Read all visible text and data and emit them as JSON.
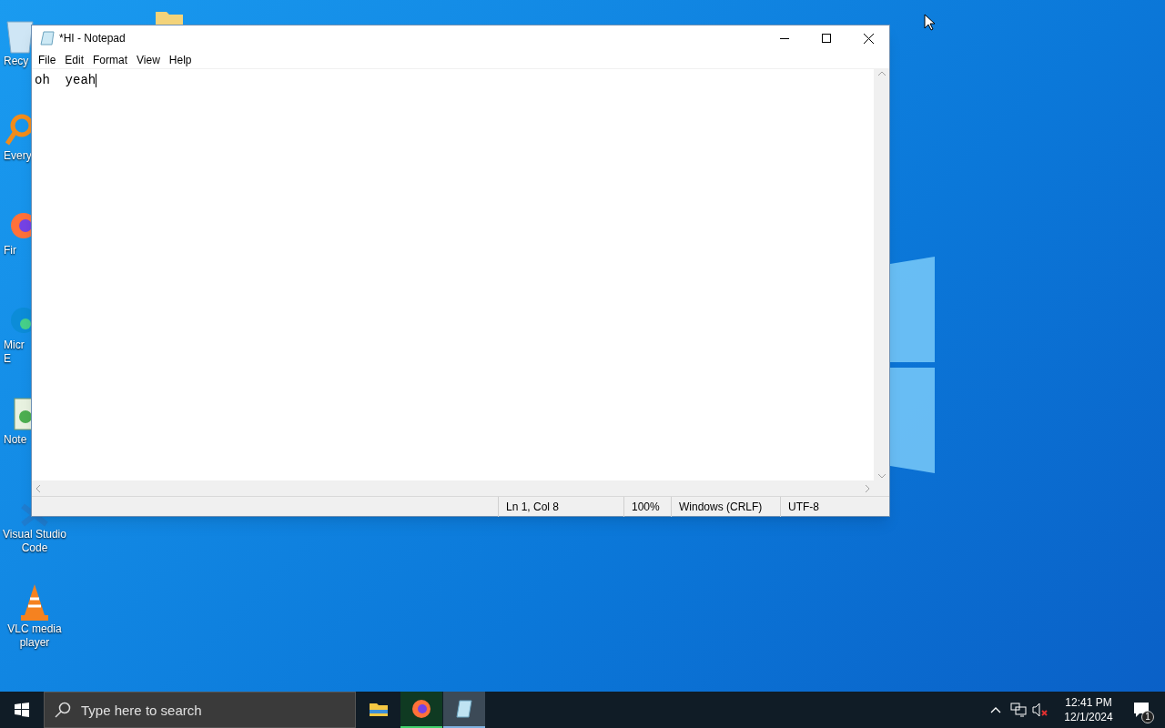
{
  "desktop_icons": [
    {
      "kind": "bin",
      "label": [
        "Recy"
      ]
    },
    {
      "kind": "search",
      "label": [
        "Every"
      ]
    },
    {
      "kind": "firefox",
      "label": [
        "Fir"
      ]
    },
    {
      "kind": "edge",
      "label": [
        "Micr",
        "E"
      ]
    },
    {
      "kind": "notepad",
      "label": [
        "Note"
      ]
    },
    {
      "kind": "vscode",
      "label": [
        "Visual Studio",
        "Code"
      ]
    },
    {
      "kind": "vlc",
      "label": [
        "VLC media",
        "player"
      ]
    }
  ],
  "window": {
    "title": "*HI - Notepad",
    "menu": [
      "File",
      "Edit",
      "Format",
      "View",
      "Help"
    ],
    "content": "oh  yeah",
    "status_bar": [
      "Ln 1, Col 8",
      "100%",
      "Windows (CRLF)",
      "UTF-8"
    ]
  },
  "taskbar": {
    "search": {
      "placeholder": "Type here to search"
    },
    "apps": [
      {
        "kind": "explorer",
        "running": false,
        "selected": false
      },
      {
        "kind": "firefox",
        "running": true,
        "selected": false
      },
      {
        "kind": "notepad",
        "running": true,
        "selected": true
      }
    ],
    "time": "12:41 PM",
    "date": "12/1/2024",
    "notifications": "1"
  }
}
